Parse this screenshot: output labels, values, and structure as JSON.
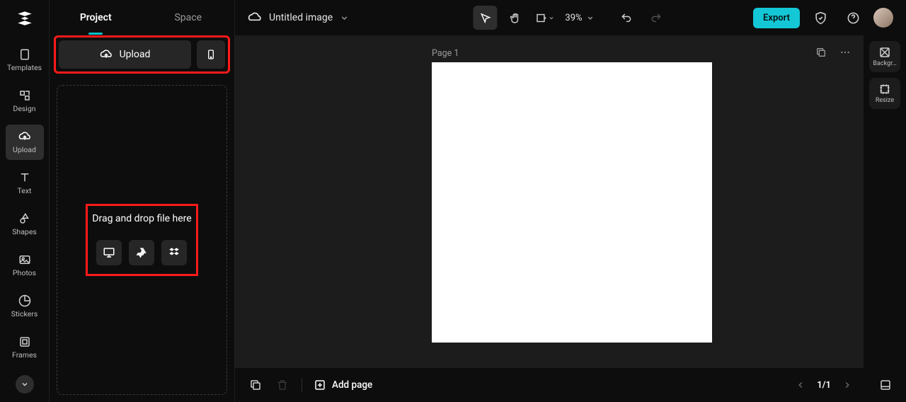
{
  "rail": {
    "items": [
      {
        "label": "Templates"
      },
      {
        "label": "Design"
      },
      {
        "label": "Upload"
      },
      {
        "label": "Text"
      },
      {
        "label": "Shapes"
      },
      {
        "label": "Photos"
      },
      {
        "label": "Stickers"
      },
      {
        "label": "Frames"
      }
    ]
  },
  "panel": {
    "tabs": [
      {
        "label": "Project"
      },
      {
        "label": "Space"
      }
    ],
    "upload_label": "Upload",
    "drop_text": "Drag and drop file here"
  },
  "header": {
    "title": "Untitled image",
    "zoom": "39%",
    "export_label": "Export"
  },
  "canvas": {
    "page_label": "Page 1"
  },
  "right_rail": {
    "items": [
      {
        "label": "Backgr…"
      },
      {
        "label": "Resize"
      }
    ]
  },
  "bottom": {
    "add_page_label": "Add page",
    "pager": "1/1"
  }
}
